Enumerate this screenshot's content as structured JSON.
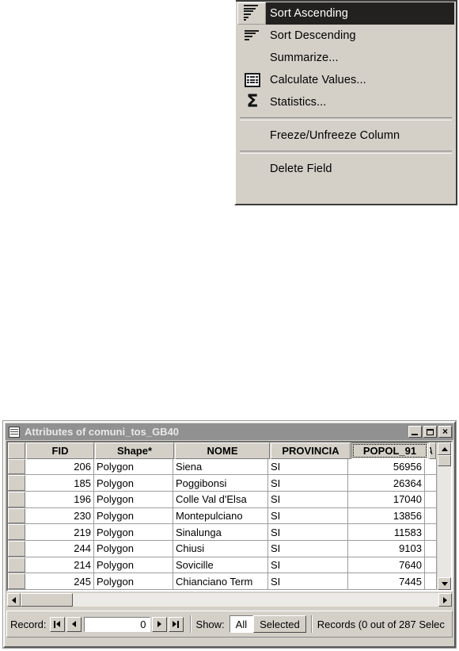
{
  "context_menu": {
    "items": [
      {
        "label": "Sort Ascending",
        "icon": "sort-ascending-icon",
        "highlighted": true,
        "separator_after": false
      },
      {
        "label": "Sort Descending",
        "icon": "sort-descending-icon",
        "highlighted": false,
        "separator_after": false
      },
      {
        "label": "Summarize...",
        "icon": "none",
        "highlighted": false,
        "separator_after": false
      },
      {
        "label": "Calculate Values...",
        "icon": "calculator-icon",
        "highlighted": false,
        "separator_after": false
      },
      {
        "label": "Statistics...",
        "icon": "sigma-icon",
        "highlighted": false,
        "separator_after": true
      },
      {
        "label": "Freeze/Unfreeze Column",
        "icon": "none",
        "highlighted": false,
        "separator_after": true
      },
      {
        "label": "Delete Field",
        "icon": "none",
        "highlighted": false,
        "separator_after": false
      }
    ]
  },
  "window": {
    "title": "Attributes of comuni_tos_GB40",
    "title_icon": "table-icon",
    "buttons": {
      "minimize": "minimize-button",
      "maximize": "maximize-button",
      "close": "close-button",
      "close_glyph": "×"
    }
  },
  "table": {
    "columns": [
      {
        "label": "FID",
        "align": "right",
        "selected": false
      },
      {
        "label": "Shape*",
        "align": "left",
        "selected": false
      },
      {
        "label": "NOME",
        "align": "left",
        "selected": false
      },
      {
        "label": "PROVINCIA",
        "align": "left",
        "selected": false
      },
      {
        "label": "POPOL_91",
        "align": "right",
        "selected": true
      },
      {
        "label": "A",
        "align": "right",
        "selected": false
      }
    ],
    "rows": [
      {
        "FID": "206",
        "Shape": "Polygon",
        "NOME": "Siena",
        "PROVINCIA": "SI",
        "POPOL_91": "56956",
        "A": ""
      },
      {
        "FID": "185",
        "Shape": "Polygon",
        "NOME": "Poggibonsi",
        "PROVINCIA": "SI",
        "POPOL_91": "26364",
        "A": ""
      },
      {
        "FID": "196",
        "Shape": "Polygon",
        "NOME": "Colle Val d'Elsa",
        "PROVINCIA": "SI",
        "POPOL_91": "17040",
        "A": ""
      },
      {
        "FID": "230",
        "Shape": "Polygon",
        "NOME": "Montepulciano",
        "PROVINCIA": "SI",
        "POPOL_91": "13856",
        "A": ""
      },
      {
        "FID": "219",
        "Shape": "Polygon",
        "NOME": "Sinalunga",
        "PROVINCIA": "SI",
        "POPOL_91": "11583",
        "A": ""
      },
      {
        "FID": "244",
        "Shape": "Polygon",
        "NOME": "Chiusi",
        "PROVINCIA": "SI",
        "POPOL_91": "9103",
        "A": ""
      },
      {
        "FID": "214",
        "Shape": "Polygon",
        "NOME": "Sovicille",
        "PROVINCIA": "SI",
        "POPOL_91": "7640",
        "A": ""
      },
      {
        "FID": "245",
        "Shape": "Polygon",
        "NOME": "Chianciano Term",
        "PROVINCIA": "SI",
        "POPOL_91": "7445",
        "A": ""
      }
    ]
  },
  "status_bar": {
    "record_label": "Record:",
    "record_value": "0",
    "first_button": "first-record-button",
    "prev_button": "previous-record-button",
    "next_button": "next-record-button",
    "last_button": "last-record-button",
    "show_label": "Show:",
    "show_all": "All",
    "show_selected": "Selected",
    "records_text": "Records  (0 out of 287 Selec"
  },
  "colors": {
    "face": "#d4d0c8",
    "highlight": "#23211f",
    "title_bar": "#919191",
    "grid_line": "#9d9d9d"
  }
}
